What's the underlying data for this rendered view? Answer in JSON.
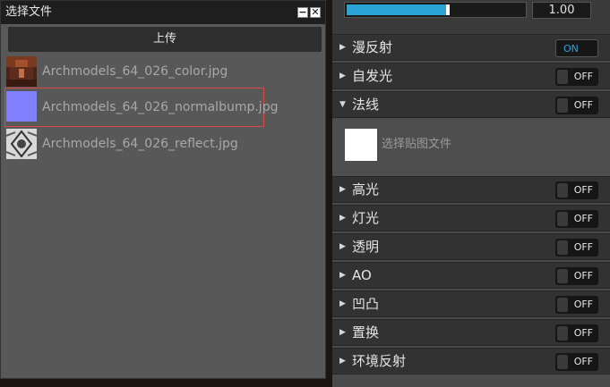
{
  "dialog": {
    "title": "选择文件",
    "minimize_glyph": "−",
    "close_glyph": "✕",
    "upload_label": "上传",
    "files": [
      {
        "name": "Archmodels_64_026_color.jpg",
        "thumb": "color-texture",
        "selected": false
      },
      {
        "name": "Archmodels_64_026_normalbump.jpg",
        "thumb": "normal-map",
        "selected": true
      },
      {
        "name": "Archmodels_64_026_reflect.jpg",
        "thumb": "reflect-texture",
        "selected": false
      }
    ]
  },
  "panel": {
    "slider": {
      "value": 1.0,
      "display": "1.00",
      "fill_fraction": 0.5
    },
    "sections": [
      {
        "label": "漫反射",
        "state": "ON",
        "expanded": false
      },
      {
        "label": "自发光",
        "state": "OFF",
        "expanded": false
      },
      {
        "label": "法线",
        "state": "OFF",
        "expanded": true
      },
      {
        "label": "高光",
        "state": "OFF",
        "expanded": false
      },
      {
        "label": "灯光",
        "state": "OFF",
        "expanded": false
      },
      {
        "label": "透明",
        "state": "OFF",
        "expanded": false
      },
      {
        "label": "AO",
        "state": "OFF",
        "expanded": false
      },
      {
        "label": "凹凸",
        "state": "OFF",
        "expanded": false
      },
      {
        "label": "置换",
        "state": "OFF",
        "expanded": false
      },
      {
        "label": "环境反射",
        "state": "OFF",
        "expanded": false
      }
    ],
    "normal_texture_label": "选择贴图文件"
  },
  "colors": {
    "accent": "#2aa3d6",
    "selection_border": "#d84a4a"
  }
}
